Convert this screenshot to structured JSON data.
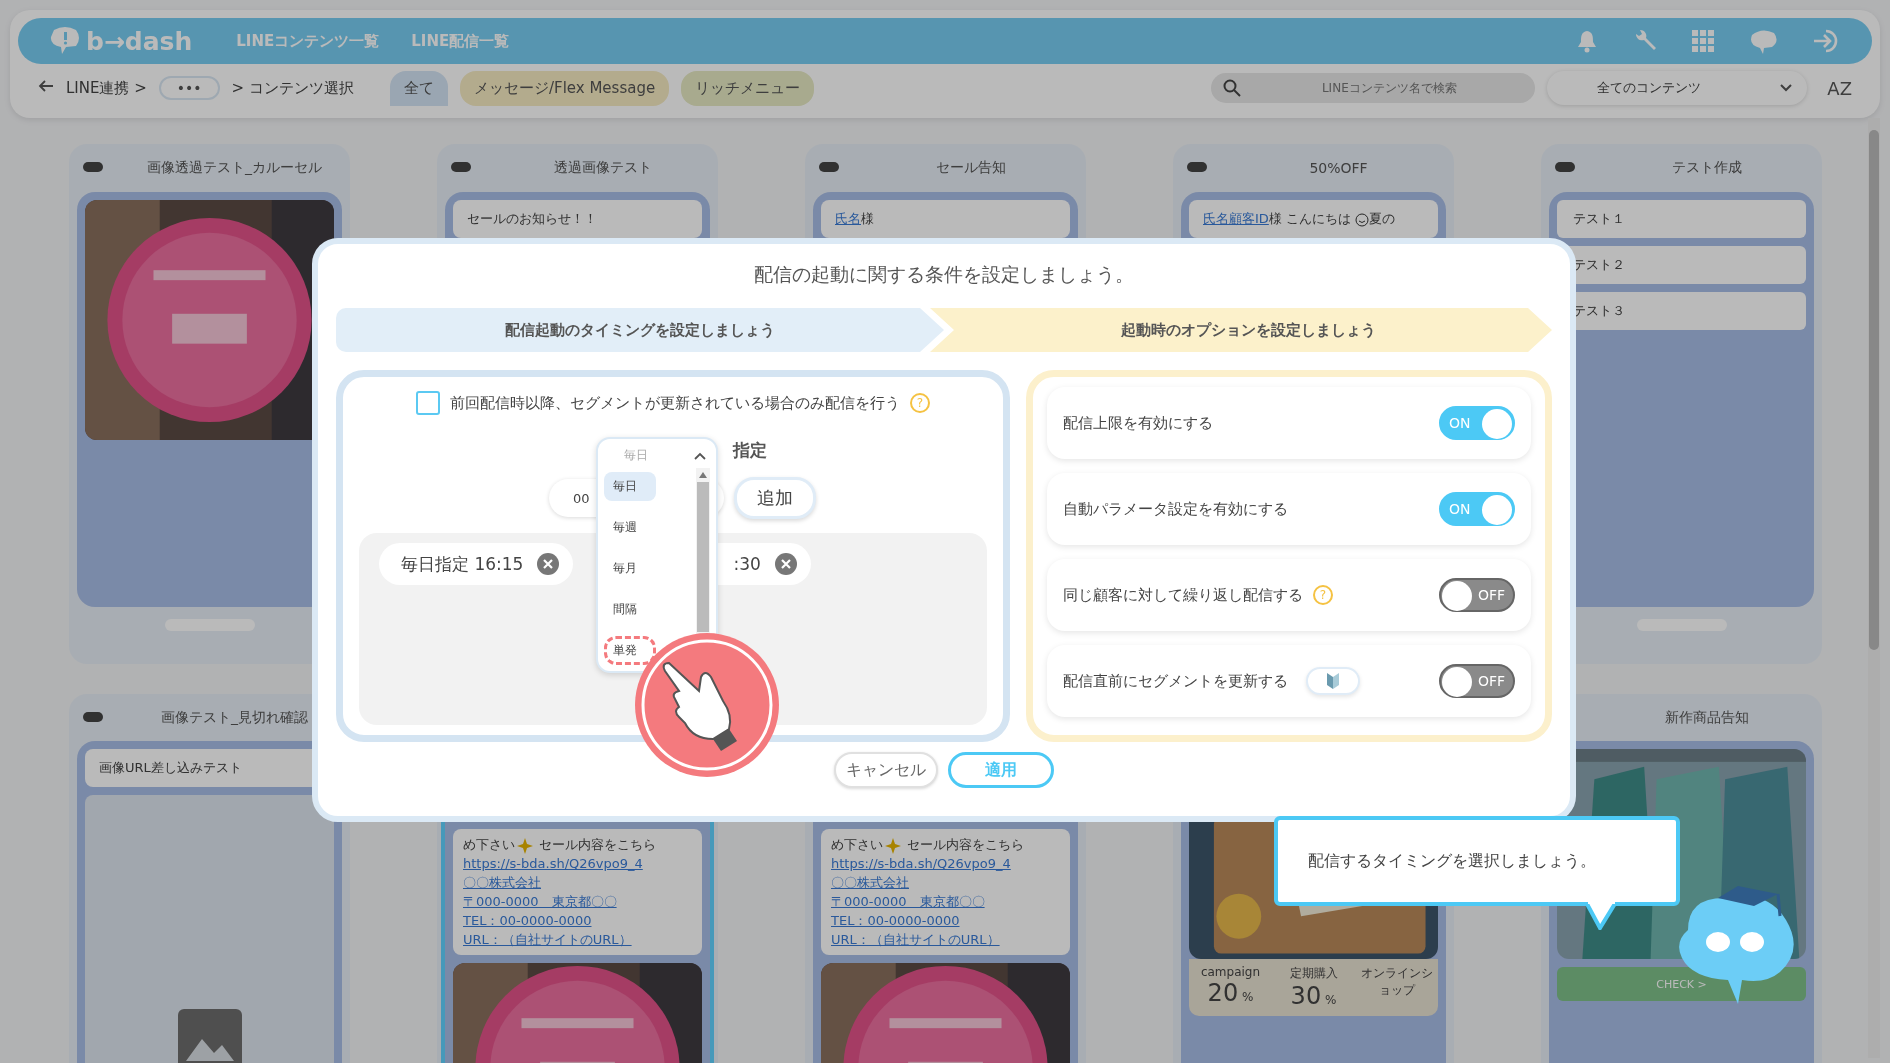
{
  "header": {
    "logo": "b→dash",
    "nav": [
      "LINEコンテンツ一覧",
      "LINE配信一覧"
    ]
  },
  "toolbar": {
    "breadcrumb": [
      {
        "label": "LINE連携 >",
        "kind": "link"
      },
      {
        "label": "•••",
        "kind": "more"
      },
      {
        "label": "> コンテンツ選択",
        "kind": "current"
      }
    ],
    "filters": [
      {
        "label": "全て",
        "selected": true
      },
      {
        "label": "メッセージ/Flex Message",
        "selected": false
      },
      {
        "label": "リッチメニュー",
        "selected": false
      }
    ],
    "search": {
      "placeholder": "LINEコンテンツ名で検索"
    },
    "content_filter": "全てのコンテンツ",
    "sort": "AZ"
  },
  "cards": [
    {
      "title": "画像透過テスト_カルーセル",
      "selected": false,
      "body": [
        {
          "kind": "picture"
        }
      ]
    },
    {
      "title": "透過画像テスト",
      "selected": false,
      "body": [
        {
          "kind": "bubble",
          "text": "セールのお知らせ！！"
        }
      ]
    },
    {
      "title": "セール告知",
      "selected": false,
      "body": [
        {
          "kind": "bubble",
          "link": "氏名",
          "text": "様"
        }
      ]
    },
    {
      "title": "50%OFF",
      "selected": false,
      "body": [
        {
          "kind": "bubble",
          "link": "氏名顧客ID",
          "text": "様 こんにちは",
          "after": "夏の"
        }
      ]
    },
    {
      "title": "テスト作成",
      "selected": false,
      "body": [
        {
          "kind": "list",
          "items": [
            "テスト１",
            "テスト２",
            "テスト３"
          ]
        }
      ]
    },
    {
      "title": "画像テスト_見切れ確認",
      "selected": false,
      "body": [
        {
          "kind": "bubble",
          "text": "画像URL差し込みテスト"
        },
        {
          "kind": "placeholder"
        }
      ]
    },
    {
      "selected": true,
      "body": [
        {
          "kind": "lines",
          "lines": [
            "め下さい",
            "https://s-bda.sh/Q26vpo9_4",
            "〇〇株式会社",
            "〒000-0000　東京都〇〇",
            "TEL：00-0000-0000",
            "URL：（自社サイトのURL）"
          ],
          "first_tail": "セール内容をこちら"
        },
        {
          "kind": "picture"
        }
      ]
    },
    {
      "selected": false,
      "body": [
        {
          "kind": "lines",
          "lines": [
            "め下さい",
            "https://s-bda.sh/Q26vpo9_4",
            "〇〇株式会社",
            "〒000-0000　東京都〇〇",
            "TEL：00-0000-0000",
            "URL：（自社サイトのURL）"
          ],
          "first_tail": "セール内容をこちら"
        },
        {
          "kind": "picture"
        }
      ]
    },
    {
      "selected": false,
      "body": [
        {
          "kind": "picture"
        },
        {
          "kind": "stats",
          "stats": [
            {
              "label": "campaign",
              "value": "20",
              "unit": "%"
            },
            {
              "label": "定期購入",
              "value": "30",
              "unit": "%"
            },
            {
              "label": "オンラインショップ"
            }
          ]
        }
      ]
    },
    {
      "title": "新作商品告知",
      "selected": false,
      "body": [
        {
          "kind": "picture"
        },
        {
          "kind": "button",
          "label": "CHECK >"
        }
      ]
    }
  ],
  "modal": {
    "title": "配信の起動に関する条件を設定しましょう。",
    "steps": [
      {
        "label": "配信起動のタイミングを設定しましょう",
        "color": "#e2eef8"
      },
      {
        "label": "起動時のオプションを設定しましょう",
        "color": "#fcf1cb"
      }
    ],
    "timing": {
      "only_if_updated": {
        "label": "前回配信時以降、セグメントが更新されている場合のみ配信を行う",
        "checked": false,
        "help": "?"
      },
      "dropdown": {
        "value": "毎日",
        "options": [
          {
            "label": "毎日",
            "selected": true,
            "highlighted": false
          },
          {
            "label": "毎週",
            "selected": false,
            "highlighted": false
          },
          {
            "label": "毎月",
            "selected": false,
            "highlighted": false
          },
          {
            "label": "間隔",
            "selected": false,
            "highlighted": false
          },
          {
            "label": "単発",
            "selected": false,
            "highlighted": true
          }
        ]
      },
      "mode_label": "指定",
      "hour": "00",
      "add_button": "追加",
      "chips": [
        "毎日指定 16:15",
        ":30"
      ]
    },
    "options": [
      {
        "label": "配信上限を有効にする",
        "on": true,
        "toggle_text": "ON",
        "kind": "plain"
      },
      {
        "label": "自動パラメータ設定を有効にする",
        "on": true,
        "toggle_text": "ON",
        "kind": "plain"
      },
      {
        "label": "同じ顧客に対して繰り返し配信する",
        "on": false,
        "toggle_text": "OFF",
        "kind": "help",
        "help": "?"
      },
      {
        "label": "配信直前にセグメントを更新する",
        "on": false,
        "toggle_text": "OFF",
        "kind": "beginner"
      }
    ],
    "buttons": [
      {
        "label": "キャンセル",
        "kind": "secondary"
      },
      {
        "label": "適用",
        "kind": "primary"
      }
    ]
  },
  "tooltip": {
    "text": "配信するタイミングを選択しましょう。"
  }
}
